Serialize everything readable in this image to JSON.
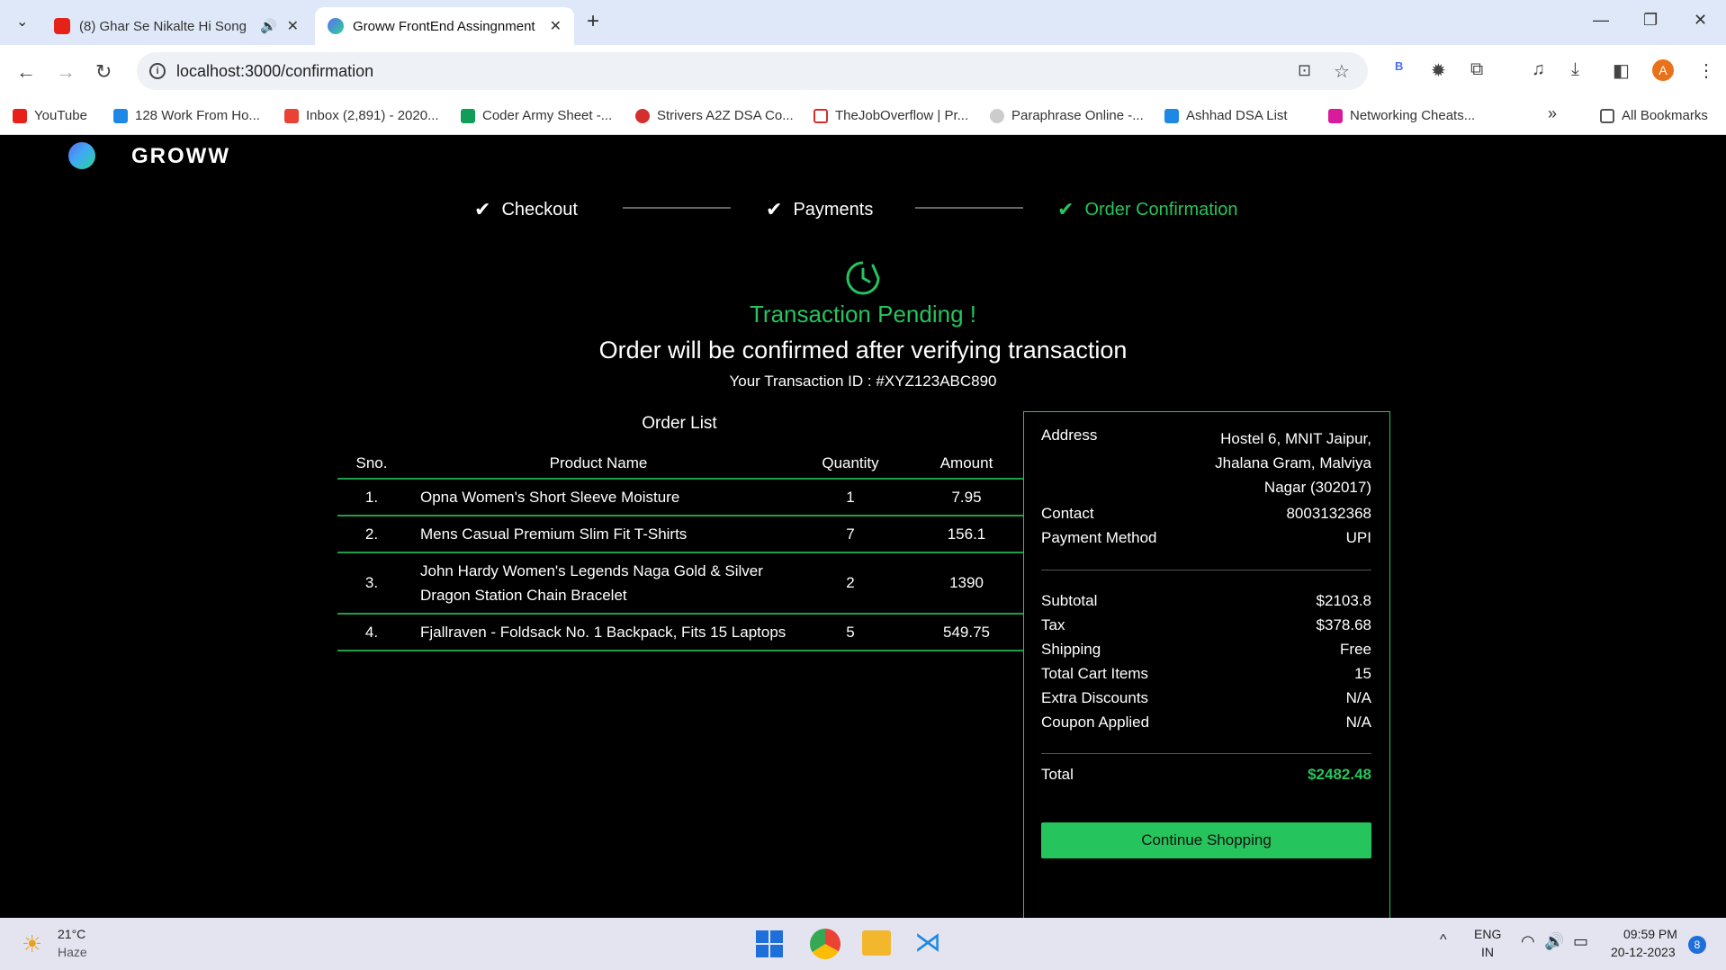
{
  "browser": {
    "tabs": [
      {
        "title": "(8) Ghar Se Nikalte Hi Song",
        "active": false
      },
      {
        "title": "Groww FrontEnd Assingnment",
        "active": true
      }
    ],
    "url": "localhost:3000/confirmation",
    "bookmarks": [
      "YouTube",
      "128 Work From Ho...",
      "Inbox (2,891) - 2020...",
      "Coder Army Sheet -...",
      "Strivers A2Z DSA Co...",
      "TheJobOverflow | Pr...",
      "Paraphrase Online -...",
      "Ashhad DSA List",
      "Networking Cheats..."
    ],
    "all_bookmarks": "All Bookmarks",
    "profile_initial": "A",
    "ext_label": "B"
  },
  "app": {
    "brand": "GROWW",
    "steps": [
      "Checkout",
      "Payments",
      "Order Confirmation"
    ],
    "status": "Transaction Pending !",
    "message": "Order will be confirmed after verifying transaction",
    "transaction": "Your Transaction ID : #XYZ123ABC890",
    "order_list_title": "Order List",
    "columns": [
      "Sno.",
      "Product Name",
      "Quantity",
      "Amount"
    ],
    "orders": [
      {
        "sno": "1.",
        "name": "Opna Women's Short Sleeve Moisture",
        "qty": "1",
        "amount": "7.95"
      },
      {
        "sno": "2.",
        "name": "Mens Casual Premium Slim Fit T-Shirts",
        "qty": "7",
        "amount": "156.1"
      },
      {
        "sno": "3.",
        "name": "John Hardy Women's Legends Naga Gold & Silver Dragon Station Chain Bracelet",
        "qty": "2",
        "amount": "1390"
      },
      {
        "sno": "4.",
        "name": "Fjallraven - Foldsack No. 1 Backpack, Fits 15 Laptops",
        "qty": "5",
        "amount": "549.75"
      }
    ],
    "summary": {
      "address_label": "Address",
      "address": "Hostel 6, MNIT Jaipur, Jhalana Gram, Malviya Nagar (302017)",
      "contact_label": "Contact",
      "contact": "8003132368",
      "payment_label": "Payment Method",
      "payment": "UPI",
      "subtotal_label": "Subtotal",
      "subtotal": "$2103.8",
      "tax_label": "Tax",
      "tax": "$378.68",
      "shipping_label": "Shipping",
      "shipping": "Free",
      "items_label": "Total Cart Items",
      "items": "15",
      "discount_label": "Extra Discounts",
      "discount": "N/A",
      "coupon_label": "Coupon Applied",
      "coupon": "N/A",
      "total_label": "Total",
      "total": "$2482.48",
      "continue": "Continue Shopping"
    }
  },
  "taskbar": {
    "temp": "21°C",
    "weather": "Haze",
    "lang": "ENG",
    "region": "IN",
    "time": "09:59 PM",
    "date": "20-12-2023",
    "notif": "8"
  },
  "colors": {
    "accent": "#26c45c",
    "background": "#000000"
  }
}
